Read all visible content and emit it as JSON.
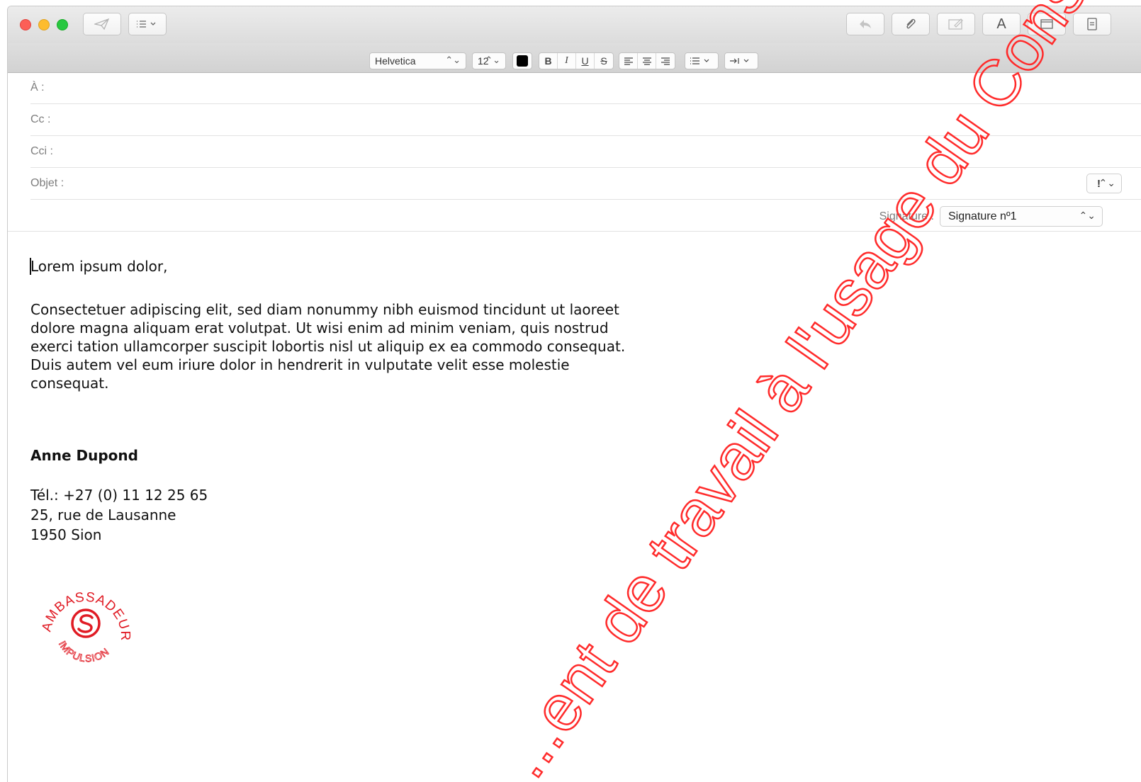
{
  "toolbar": {
    "icons": [
      "send-icon",
      "header-fields-icon",
      "reply-icon",
      "attachment-icon",
      "markup-icon",
      "format-icon",
      "browser-icon",
      "photo-browser-icon"
    ],
    "format_icon_label": "A"
  },
  "format_bar": {
    "font": "Helvetica",
    "size": "12",
    "color": "#000000",
    "bold": "B",
    "italic": "I",
    "underline": "U",
    "strike": "S"
  },
  "headers": {
    "to_label": "À :",
    "cc_label": "Cc :",
    "bcc_label": "Cci :",
    "subject_label": "Objet :",
    "priority_value": "!"
  },
  "signature": {
    "label": "Signature :",
    "selected": "Signature nº1"
  },
  "message": {
    "greeting": "Lorem ipsum dolor,",
    "paragraph_lines": [
      "Consectetuer adipiscing elit, sed diam nonummy nibh euismod tincidunt ut laoreet",
      "dolore magna aliquam erat volutpat. Ut wisi enim ad minim veniam, quis nostrud",
      "exerci tation ullamcorper suscipit lobortis nisl ut aliquip ex ea commodo consequat.",
      "Duis autem vel eum iriure dolor in hendrerit in vulputate velit esse molestie",
      "consequat."
    ],
    "sig_name": "Anne Dupond",
    "sig_phone": "Tél.: +27 (0) 11 12 25 65",
    "sig_street": "25, rue de Lausanne",
    "sig_city": "1950 Sion"
  },
  "logo": {
    "top_text": "AMBASSADEUR",
    "bottom_text": "IMPULSION",
    "color": "#e01b24"
  },
  "watermark": {
    "text": "...ent de travail à l'usage du Conseil ge...",
    "color": "#ff2b2b"
  }
}
